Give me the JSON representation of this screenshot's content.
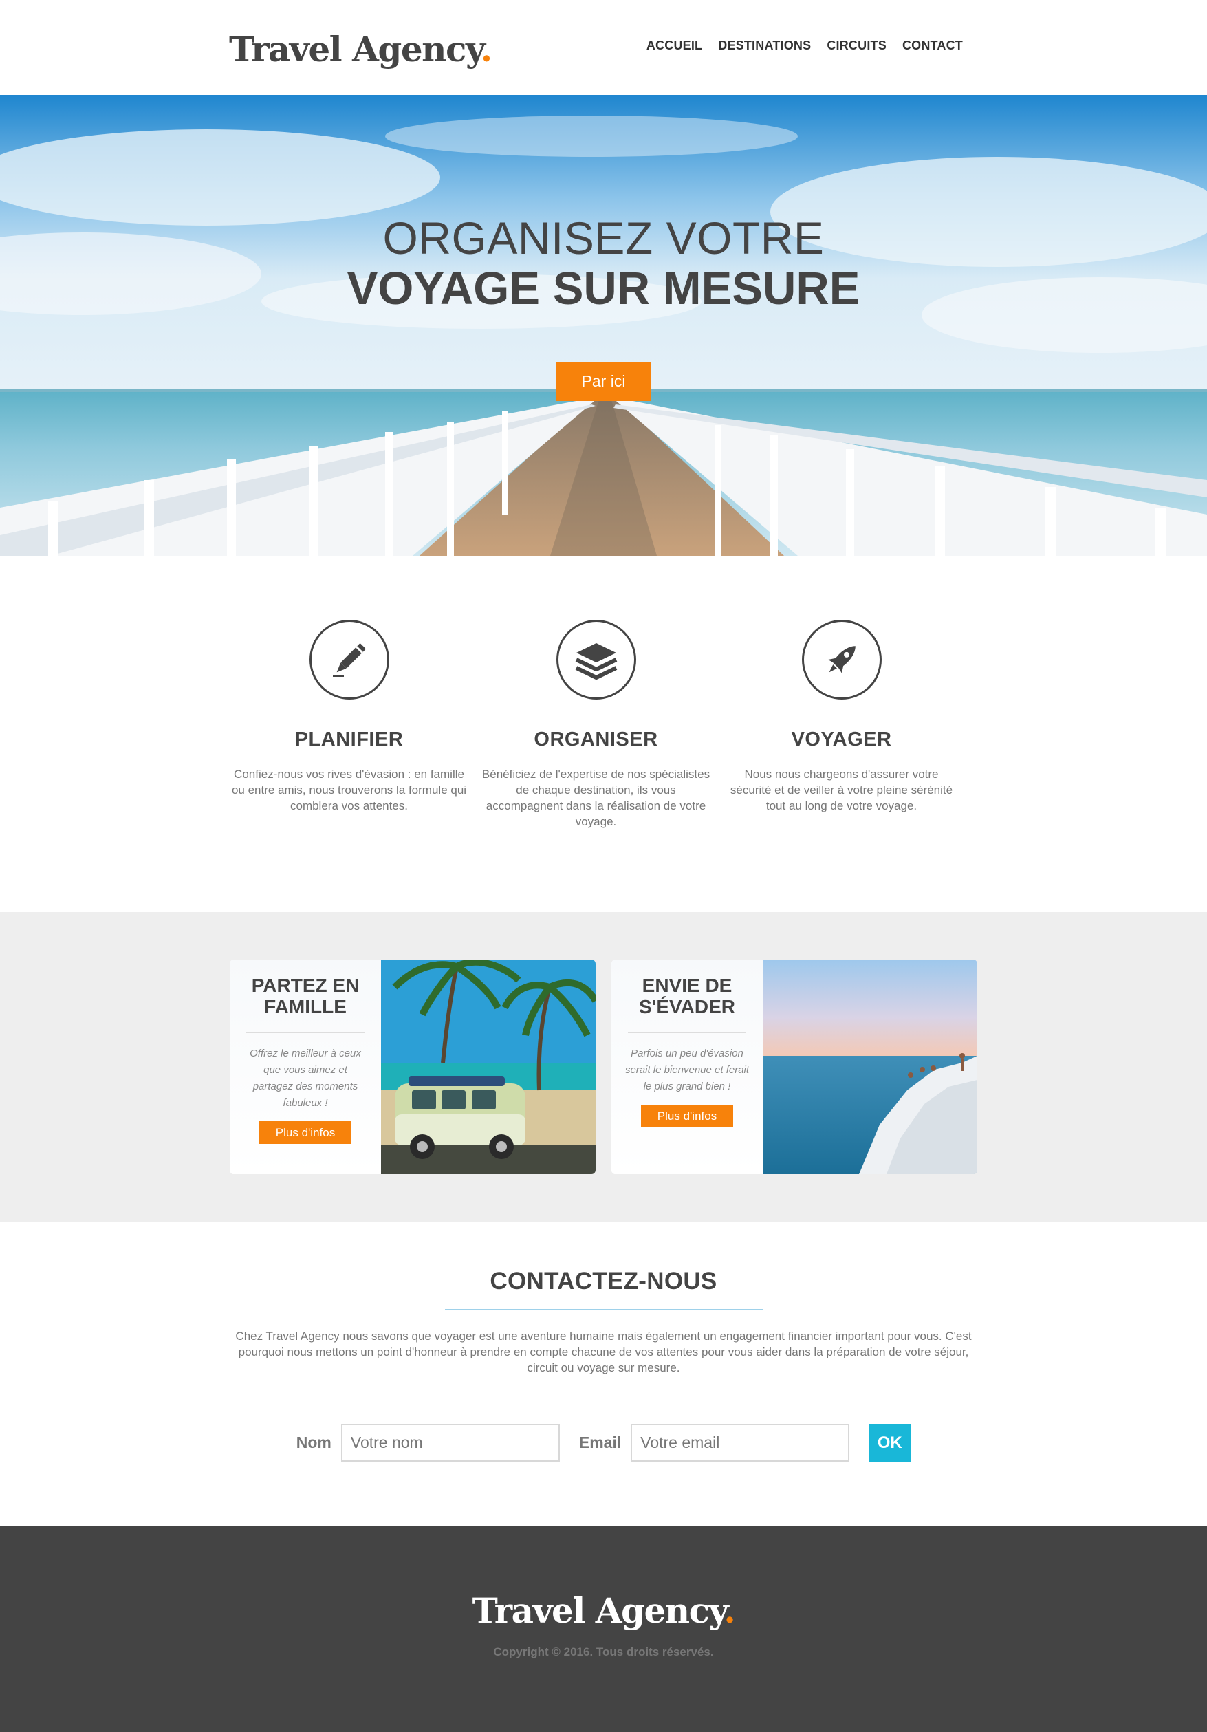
{
  "header": {
    "logo_text": "Travel Agency",
    "logo_dot": ".",
    "nav": [
      "ACCUEIL",
      "DESTINATIONS",
      "CIRCUITS",
      "CONTACT"
    ]
  },
  "hero": {
    "line1": "ORGANISEZ VOTRE",
    "line2": "VOYAGE SUR MESURE",
    "button_label": "Par ici"
  },
  "features": [
    {
      "icon": "pencil-icon",
      "title": "PLANIFIER",
      "text": "Confiez-nous vos rives d'évasion : en famille ou entre amis, nous trouverons la formule qui comblera vos attentes."
    },
    {
      "icon": "layers-icon",
      "title": "ORGANISER",
      "text": "Bénéficiez de l'expertise de nos spécialistes de chaque destination, ils vous accompagnent dans la réalisation de votre voyage."
    },
    {
      "icon": "rocket-icon",
      "title": "VOYAGER",
      "text": "Nous nous chargeons d'assurer votre sécurité et de veiller à votre pleine sérénité tout au long de votre voyage."
    }
  ],
  "cards": [
    {
      "title": "PARTEZ EN FAMILLE",
      "text": "Offrez le meilleur à ceux que vous aimez et partagez des moments fabuleux !",
      "button_label": "Plus d'infos",
      "image": "van-beach-photo"
    },
    {
      "title": "ENVIE DE S'ÉVADER",
      "text": "Parfois un peu d'évasion serait le bienvenue et ferait le plus grand bien !",
      "button_label": "Plus d'infos",
      "image": "cliff-sea-photo"
    }
  ],
  "contact": {
    "title": "CONTACTEZ-NOUS",
    "text": "Chez Travel Agency nous savons que voyager est une aventure humaine mais également un engagement financier important pour vous. C'est pourquoi nous mettons un point d'honneur à prendre en compte chacune de vos attentes pour vous aider dans la préparation de votre séjour, circuit ou voyage sur mesure.",
    "name_label": "Nom",
    "name_placeholder": "Votre nom",
    "email_label": "Email",
    "email_placeholder": "Votre email",
    "submit_label": "OK"
  },
  "footer": {
    "logo_text": "Travel Agency",
    "logo_dot": ".",
    "copyright": "Copyright © 2016. Tous droits réservés."
  },
  "colors": {
    "accent": "#f7820b",
    "submit": "#19b7d8",
    "dark": "#444444",
    "section_gray": "#eeeeee"
  }
}
